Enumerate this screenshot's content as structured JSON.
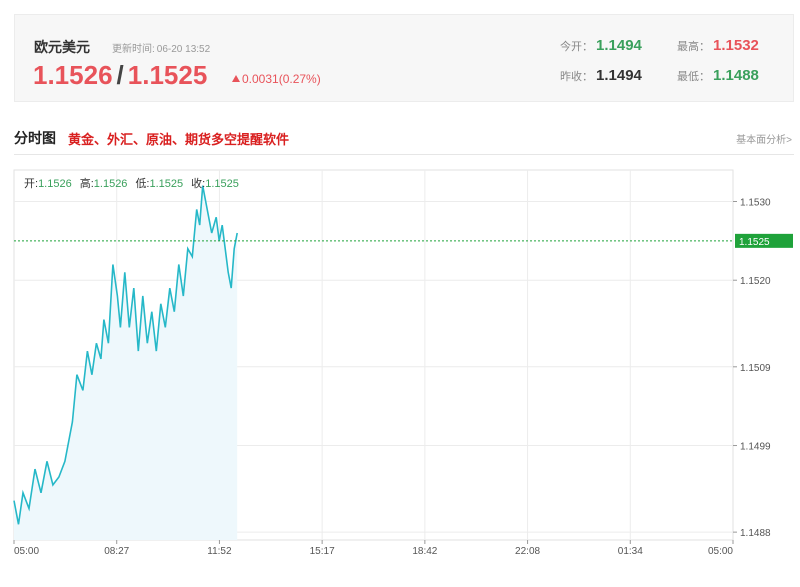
{
  "quote": {
    "name": "欧元美元",
    "time_label": "更新时间:",
    "time_value": "06-20 13:52",
    "bid": "1.1526",
    "separator": "/",
    "ask": "1.1525",
    "change": "0.0031(0.27%)",
    "open_label": "今开：",
    "open_value": "1.1494",
    "high_label": "最高：",
    "high_value": "1.1532",
    "prev_close_label": "昨收：",
    "prev_close_value": "1.1494",
    "low_label": "最低：",
    "low_value": "1.1488"
  },
  "section": {
    "title": "分时图",
    "promo": "黄金、外汇、原油、期货多空提醒软件",
    "link": "基本面分析>"
  },
  "colors": {
    "up": "#e8535a",
    "down": "#3aa05c",
    "line": "#26b8c8",
    "fill": "#eef8fc",
    "current_marker": "#1fa23a"
  },
  "chart_data": {
    "type": "area",
    "ohlc_labels": [
      {
        "label": "开:",
        "value": "1.1526"
      },
      {
        "label": "高:",
        "value": "1.1526"
      },
      {
        "label": "低:",
        "value": "1.1525"
      },
      {
        "label": "收:",
        "value": "1.1525"
      }
    ],
    "x_ticks": [
      "05:00",
      "08:27",
      "11:52",
      "15:17",
      "18:42",
      "22:08",
      "01:34",
      "05:00"
    ],
    "y_ticks": [
      "1.1530",
      "1.1520",
      "1.1509",
      "1.1499",
      "1.1488"
    ],
    "y_tick_values": [
      1.153,
      1.152,
      1.1509,
      1.1499,
      1.1488
    ],
    "ylim": [
      1.1487,
      1.1534
    ],
    "x_range_hours": 24,
    "current_price": 1.1525,
    "current_price_label": "1.1525",
    "series": [
      {
        "hours": [
          0.0,
          0.15,
          0.3,
          0.5,
          0.7,
          0.9,
          1.1,
          1.3,
          1.5,
          1.7,
          1.95,
          2.1,
          2.3,
          2.45,
          2.6,
          2.75,
          2.9,
          3.0,
          3.15,
          3.3,
          3.45,
          3.55,
          3.7,
          3.85,
          4.0,
          4.15,
          4.3,
          4.45,
          4.6,
          4.75,
          4.9,
          5.05,
          5.2,
          5.35,
          5.5,
          5.65,
          5.8,
          5.95,
          6.1,
          6.2,
          6.3,
          6.45,
          6.6,
          6.75,
          6.85,
          6.95,
          7.05,
          7.15,
          7.25,
          7.35,
          7.45
        ],
        "values": [
          1.1492,
          1.1489,
          1.1493,
          1.1491,
          1.1496,
          1.1493,
          1.1497,
          1.1494,
          1.1495,
          1.1497,
          1.1502,
          1.1508,
          1.1506,
          1.1511,
          1.1508,
          1.1512,
          1.151,
          1.1515,
          1.1512,
          1.1522,
          1.1518,
          1.1514,
          1.1521,
          1.1514,
          1.1519,
          1.1511,
          1.1518,
          1.1512,
          1.1516,
          1.1511,
          1.1517,
          1.1514,
          1.1519,
          1.1516,
          1.1522,
          1.1518,
          1.1524,
          1.1523,
          1.1529,
          1.1527,
          1.1532,
          1.1529,
          1.1526,
          1.1528,
          1.1525,
          1.1527,
          1.1524,
          1.1521,
          1.1519,
          1.1524,
          1.1526
        ]
      }
    ],
    "grid": true
  }
}
